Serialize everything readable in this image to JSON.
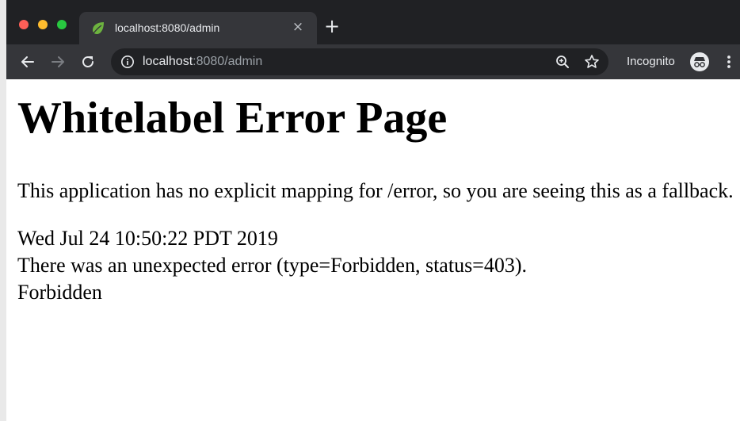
{
  "browser": {
    "tab": {
      "title": "localhost:8080/admin",
      "favicon": "spring-leaf-icon",
      "close_glyph": "×"
    },
    "new_tab_glyph": "+",
    "address_bar": {
      "host": "localhost",
      "rest": ":8080/admin"
    },
    "incognito_label": "Incognito",
    "colors": {
      "tabstrip": "#202124",
      "toolbar": "#35363a",
      "omnibox": "#202124",
      "text_light": "#e8eaed",
      "text_dim": "#9aa0a6",
      "favicon": "#6db33f"
    }
  },
  "page": {
    "title": "Whitelabel Error Page",
    "message": "This application has no explicit mapping for /error, so you are seeing this as a fallback.",
    "timestamp": "Wed Jul 24 10:50:22 PDT 2019",
    "error_line": "There was an unexpected error (type=Forbidden, status=403).",
    "error_reason": "Forbidden"
  }
}
